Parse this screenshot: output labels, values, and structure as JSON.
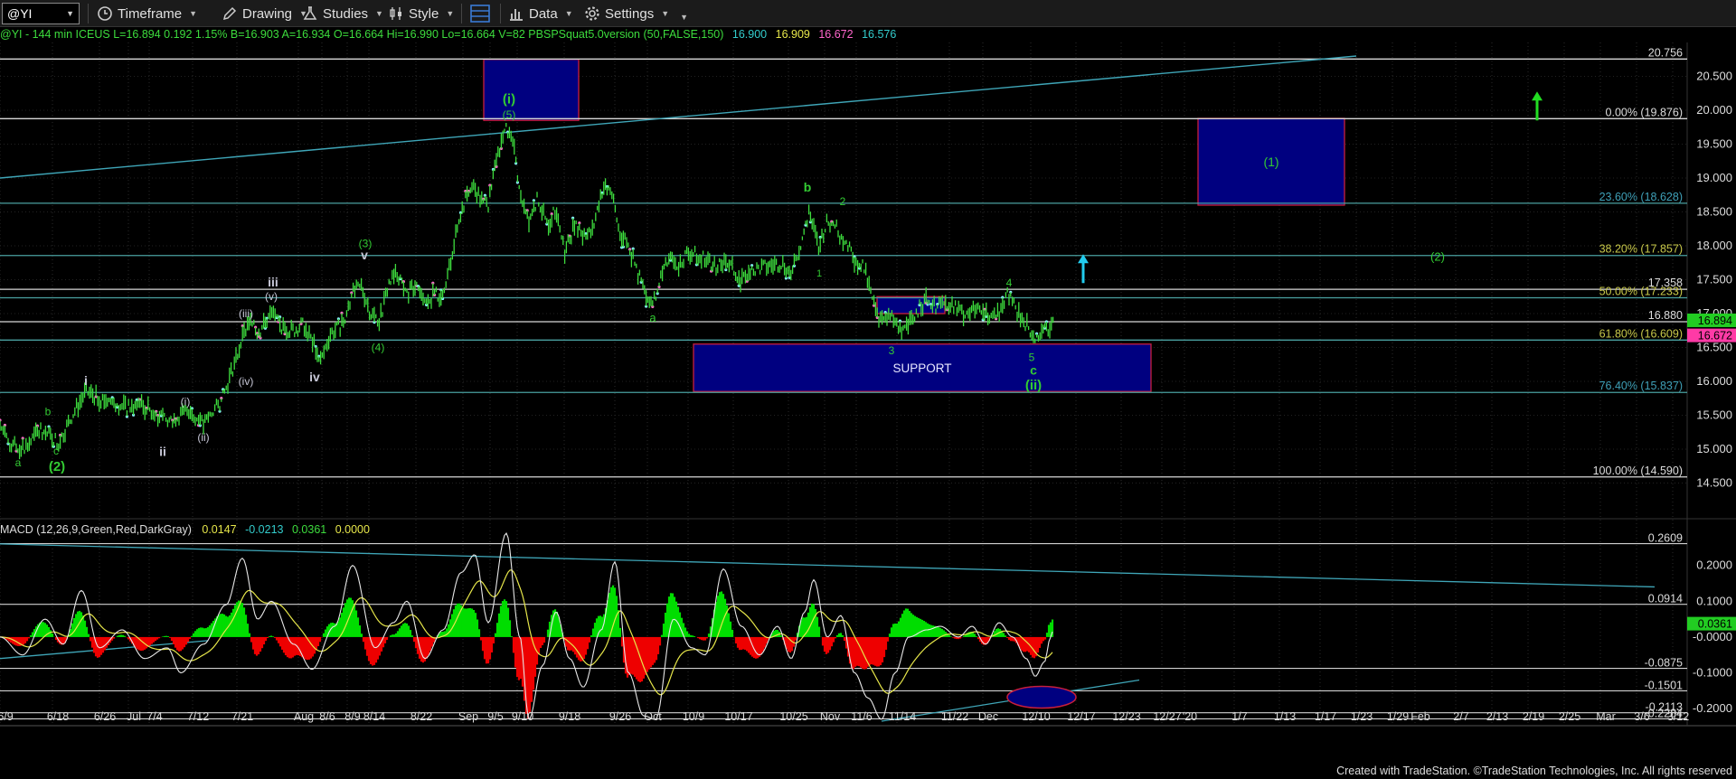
{
  "toolbar": {
    "symbol": "@YI",
    "timeframe": "Timeframe",
    "drawing": "Drawing",
    "studies": "Studies",
    "style": "Style",
    "data": "Data",
    "settings": "Settings"
  },
  "infobar": {
    "main": "@YI - 144 min  ICEUS  L=16.894  0.192  1.15%  B=16.903  A=16.934  O=16.664  Hi=16.990  Lo=16.664  V=82  PBSPSquat5.0version (50,FALSE,150)",
    "v1": "16.900",
    "v2": "16.909",
    "v3": "16.672",
    "v4": "16.576"
  },
  "colors": {
    "price": "#3ddc3d",
    "wave_green": "#33cc33",
    "wave_gray": "#c8c8d8",
    "fib": "#4aa0a0",
    "hline": "#d8d8d8",
    "box_fill": "#000080",
    "box_edge": "#c81e3c",
    "trend": "#3fa6b8",
    "macd": "#e8e8e8",
    "signal": "#e6e64a",
    "hist_pos": "#00dd00",
    "hist_neg": "#ee0000",
    "arrow_cyan": "#22ccee",
    "arrow_green": "#22dd22"
  },
  "chart_data": [
    {
      "type": "line",
      "series_name": "@YI - 144 min",
      "ylim": [
        14.0,
        21.0
      ],
      "y_ticks": [
        14.5,
        15.0,
        15.5,
        16.0,
        16.5,
        17.0,
        17.5,
        18.0,
        18.5,
        19.0,
        19.5,
        20.0,
        20.5
      ],
      "y_tick_labels": [
        "14.500",
        "15.000",
        "15.500",
        "16.000",
        "16.500",
        "17.000",
        "17.500",
        "18.000",
        "18.500",
        "19.000",
        "19.500",
        "20.000",
        "20.500"
      ],
      "x_tick_labels": [
        "6/9",
        "6/18",
        "6/26",
        "Jul",
        "7/4",
        "7/12",
        "7/21",
        "Aug",
        "8/6",
        "8/9",
        "8/14",
        "8/22",
        "Sep",
        "9/5",
        "9/10",
        "9/18",
        "9/26",
        "Oct",
        "10/9",
        "10/17",
        "10/25",
        "Nov",
        "11/6",
        "11/14",
        "11/22",
        "Dec",
        "12/10",
        "12/17",
        "12/23",
        "12/27",
        "'20",
        "1/7",
        "1/13",
        "1/17",
        "1/23",
        "1/29",
        "Feb",
        "2/7",
        "2/13",
        "2/19",
        "2/25",
        "Mar",
        "3/6",
        "3/12"
      ],
      "x_tick_pos": [
        0,
        0.058,
        0.11,
        0.142,
        0.165,
        0.213,
        0.262,
        0.33,
        0.356,
        0.384,
        0.408,
        0.46,
        0.512,
        0.542,
        0.572,
        0.624,
        0.68,
        0.716,
        0.761,
        0.811,
        0.872,
        0.912,
        0.947,
        0.992,
        1.05,
        1.087,
        1.14,
        1.19,
        1.24,
        1.285,
        1.31,
        1.365,
        1.415,
        1.46,
        1.5,
        1.54,
        1.565,
        1.61,
        1.65,
        1.69,
        1.73,
        1.77,
        1.81,
        1.85
      ],
      "price_path": [
        [
          0,
          15.35
        ],
        [
          0.01,
          15.1
        ],
        [
          0.02,
          15.0
        ],
        [
          0.03,
          15.05
        ],
        [
          0.045,
          15.3
        ],
        [
          0.055,
          15.2
        ],
        [
          0.065,
          15.1
        ],
        [
          0.08,
          15.5
        ],
        [
          0.095,
          15.85
        ],
        [
          0.11,
          15.75
        ],
        [
          0.125,
          15.7
        ],
        [
          0.14,
          15.6
        ],
        [
          0.155,
          15.65
        ],
        [
          0.17,
          15.55
        ],
        [
          0.185,
          15.4
        ],
        [
          0.2,
          15.5
        ],
        [
          0.21,
          15.6
        ],
        [
          0.225,
          15.35
        ],
        [
          0.235,
          15.55
        ],
        [
          0.245,
          15.7
        ],
        [
          0.255,
          16.1
        ],
        [
          0.265,
          16.5
        ],
        [
          0.275,
          16.9
        ],
        [
          0.285,
          16.7
        ],
        [
          0.295,
          16.9
        ],
        [
          0.3,
          17.0
        ],
        [
          0.31,
          16.8
        ],
        [
          0.325,
          16.75
        ],
        [
          0.335,
          16.85
        ],
        [
          0.345,
          16.6
        ],
        [
          0.355,
          16.3
        ],
        [
          0.365,
          16.7
        ],
        [
          0.38,
          16.85
        ],
        [
          0.39,
          17.3
        ],
        [
          0.4,
          17.4
        ],
        [
          0.41,
          17.0
        ],
        [
          0.42,
          16.9
        ],
        [
          0.43,
          17.45
        ],
        [
          0.44,
          17.6
        ],
        [
          0.45,
          17.3
        ],
        [
          0.46,
          17.4
        ],
        [
          0.47,
          17.1
        ],
        [
          0.48,
          17.3
        ],
        [
          0.49,
          17.2
        ],
        [
          0.5,
          17.9
        ],
        [
          0.51,
          18.5
        ],
        [
          0.52,
          18.9
        ],
        [
          0.53,
          18.7
        ],
        [
          0.54,
          18.6
        ],
        [
          0.55,
          19.3
        ],
        [
          0.56,
          19.75
        ],
        [
          0.568,
          19.5
        ],
        [
          0.575,
          18.8
        ],
        [
          0.585,
          18.4
        ],
        [
          0.595,
          18.7
        ],
        [
          0.605,
          18.3
        ],
        [
          0.615,
          18.55
        ],
        [
          0.625,
          17.9
        ],
        [
          0.635,
          18.3
        ],
        [
          0.645,
          18.15
        ],
        [
          0.655,
          18.2
        ],
        [
          0.665,
          18.8
        ],
        [
          0.675,
          18.85
        ],
        [
          0.685,
          18.2
        ],
        [
          0.695,
          18.0
        ],
        [
          0.705,
          17.6
        ],
        [
          0.715,
          17.3
        ],
        [
          0.722,
          17.15
        ],
        [
          0.73,
          17.5
        ],
        [
          0.74,
          17.8
        ],
        [
          0.75,
          17.7
        ],
        [
          0.76,
          17.9
        ],
        [
          0.775,
          17.85
        ],
        [
          0.79,
          17.7
        ],
        [
          0.805,
          17.75
        ],
        [
          0.82,
          17.5
        ],
        [
          0.835,
          17.65
        ],
        [
          0.85,
          17.7
        ],
        [
          0.865,
          17.75
        ],
        [
          0.875,
          17.6
        ],
        [
          0.885,
          18.0
        ],
        [
          0.895,
          18.5
        ],
        [
          0.905,
          18.0
        ],
        [
          0.915,
          18.35
        ],
        [
          0.925,
          18.25
        ],
        [
          0.935,
          18.05
        ],
        [
          0.945,
          17.8
        ],
        [
          0.955,
          17.7
        ],
        [
          0.965,
          17.2
        ],
        [
          0.975,
          16.85
        ],
        [
          0.985,
          16.95
        ],
        [
          0.995,
          16.75
        ],
        [
          1.005,
          16.9
        ],
        [
          1.015,
          17.05
        ],
        [
          1.025,
          17.2
        ],
        [
          1.035,
          17.1
        ],
        [
          1.05,
          17.15
        ],
        [
          1.065,
          17.0
        ],
        [
          1.08,
          17.05
        ],
        [
          1.095,
          16.95
        ],
        [
          1.105,
          17.0
        ],
        [
          1.115,
          17.3
        ],
        [
          1.125,
          17.0
        ],
        [
          1.135,
          16.85
        ],
        [
          1.143,
          16.62
        ],
        [
          1.15,
          16.7
        ],
        [
          1.158,
          16.76
        ],
        [
          1.165,
          16.9
        ]
      ],
      "h_lines": [
        {
          "value": 20.756,
          "label": "20.756"
        },
        {
          "value": 19.876,
          "label": "0.00% (19.876)",
          "kind": "fib"
        },
        {
          "value": 18.628,
          "label": "23.60% (18.628)",
          "kind": "fib"
        },
        {
          "value": 17.857,
          "label": "38.20% (17.857)",
          "kind": "fib"
        },
        {
          "value": 17.358,
          "label": "17.358"
        },
        {
          "value": 17.233,
          "label": "50.00% (17.233)",
          "kind": "fib"
        },
        {
          "value": 16.88,
          "label": "16.880"
        },
        {
          "value": 16.609,
          "label": "61.80% (16.609)",
          "kind": "fib"
        },
        {
          "value": 15.837,
          "label": "76.40% (15.837)",
          "kind": "fib"
        },
        {
          "value": 14.59,
          "label": "100.00% (14.590)"
        }
      ],
      "price_tags": [
        {
          "value": 16.894,
          "label": "16.894",
          "bg": "#22cc22"
        },
        {
          "value": 16.672,
          "label": "16.672",
          "bg": "#ff3aa6"
        }
      ],
      "trendline": [
        [
          0,
          19.0
        ],
        [
          1.5,
          20.8
        ]
      ],
      "boxes": [
        {
          "x0": 0.535,
          "x1": 0.64,
          "y0": 19.85,
          "y1": 20.75,
          "label": ""
        },
        {
          "x0": 1.325,
          "x1": 1.487,
          "y0": 18.6,
          "y1": 19.88,
          "label": "(1)"
        },
        {
          "x0": 0.767,
          "x1": 1.273,
          "y0": 15.85,
          "y1": 16.55,
          "label": "SUPPORT"
        },
        {
          "x0": 0.97,
          "x1": 1.045,
          "y0": 17.0,
          "y1": 17.25,
          "label": ""
        }
      ],
      "wave_labels": [
        {
          "x": 0.02,
          "y": 14.75,
          "t": "a",
          "c": "g",
          "s": 12
        },
        {
          "x": 0.053,
          "y": 15.5,
          "t": "b",
          "c": "g",
          "s": 12
        },
        {
          "x": 0.062,
          "y": 14.92,
          "t": "c",
          "c": "g",
          "s": 12
        },
        {
          "x": 0.063,
          "y": 14.68,
          "t": "(2)",
          "c": "g",
          "s": 15
        },
        {
          "x": 0.095,
          "y": 15.95,
          "t": "i",
          "c": "w",
          "s": 14
        },
        {
          "x": 0.18,
          "y": 14.9,
          "t": "ii",
          "c": "w",
          "s": 14
        },
        {
          "x": 0.205,
          "y": 15.65,
          "t": "(i)",
          "c": "w",
          "s": 12
        },
        {
          "x": 0.225,
          "y": 15.12,
          "t": "(ii)",
          "c": "w",
          "s": 12
        },
        {
          "x": 0.272,
          "y": 16.95,
          "t": "(iii)",
          "c": "w",
          "s": 12
        },
        {
          "x": 0.272,
          "y": 15.95,
          "t": "(iv)",
          "c": "w",
          "s": 12
        },
        {
          "x": 0.3,
          "y": 17.2,
          "t": "(v)",
          "c": "w",
          "s": 12
        },
        {
          "x": 0.302,
          "y": 17.4,
          "t": "iii",
          "c": "w",
          "s": 14
        },
        {
          "x": 0.348,
          "y": 16.0,
          "t": "iv",
          "c": "w",
          "s": 14
        },
        {
          "x": 0.403,
          "y": 17.8,
          "t": "v",
          "c": "w",
          "s": 14
        },
        {
          "x": 0.404,
          "y": 17.98,
          "t": "(3)",
          "c": "g",
          "s": 12
        },
        {
          "x": 0.418,
          "y": 16.45,
          "t": "(4)",
          "c": "g",
          "s": 12
        },
        {
          "x": 0.563,
          "y": 20.1,
          "t": "(i)",
          "c": "g",
          "s": 15
        },
        {
          "x": 0.563,
          "y": 19.88,
          "t": "(5)",
          "c": "g",
          "s": 12
        },
        {
          "x": 0.722,
          "y": 16.88,
          "t": "a",
          "c": "g",
          "s": 13
        },
        {
          "x": 0.893,
          "y": 18.8,
          "t": "b",
          "c": "g",
          "s": 14
        },
        {
          "x": 0.906,
          "y": 17.55,
          "t": "1",
          "c": "g",
          "s": 11
        },
        {
          "x": 0.932,
          "y": 18.6,
          "t": "2",
          "c": "g",
          "s": 12
        },
        {
          "x": 0.986,
          "y": 16.4,
          "t": "3",
          "c": "g",
          "s": 12
        },
        {
          "x": 1.116,
          "y": 17.4,
          "t": "4",
          "c": "g",
          "s": 12
        },
        {
          "x": 1.141,
          "y": 16.3,
          "t": "5",
          "c": "g",
          "s": 12
        },
        {
          "x": 1.143,
          "y": 16.1,
          "t": "c",
          "c": "g",
          "s": 14
        },
        {
          "x": 1.143,
          "y": 15.88,
          "t": "(ii)",
          "c": "g",
          "s": 15
        },
        {
          "x": 1.59,
          "y": 17.78,
          "t": "(2)",
          "c": "g",
          "s": 13
        }
      ],
      "arrows": [
        {
          "x": 1.198,
          "y0": 17.45,
          "y1": 17.85,
          "color": "cyan"
        },
        {
          "x": 1.7,
          "y0": 19.85,
          "y1": 20.25,
          "color": "green"
        }
      ]
    },
    {
      "type": "line",
      "indicator": "MACD (12,26,9,Green,Red,DarkGray)",
      "header_values": [
        "0.0147",
        "-0.0213",
        "0.0361",
        "0.0000"
      ],
      "ylim": [
        -0.245,
        0.29
      ],
      "y_ticks": [
        -0.2,
        -0.1,
        0.0,
        0.1,
        0.2
      ],
      "y_tick_labels": [
        "-0.2000",
        "-0.1000",
        "-0.0000",
        "0.1000",
        "0.2000"
      ],
      "h_lines": [
        {
          "value": 0.2609,
          "label": "0.2609"
        },
        {
          "value": 0.0914,
          "label": "0.0914"
        },
        {
          "value": -0.0875,
          "label": "-0.0875"
        },
        {
          "value": -0.1501,
          "label": "-0.1501"
        },
        {
          "value": -0.2113,
          "label": "-0.2113"
        },
        {
          "value": -0.2284,
          "label": "-0.2284"
        }
      ],
      "price_tag": {
        "value": 0.0361,
        "label": "0.0361"
      },
      "macd_keys": [
        [
          0,
          0
        ],
        [
          0.025,
          -0.05
        ],
        [
          0.05,
          0.05
        ],
        [
          0.07,
          -0.02
        ],
        [
          0.09,
          0.13
        ],
        [
          0.11,
          -0.03
        ],
        [
          0.135,
          0.02
        ],
        [
          0.16,
          -0.06
        ],
        [
          0.185,
          -0.03
        ],
        [
          0.2,
          -0.1
        ],
        [
          0.225,
          -0.02
        ],
        [
          0.25,
          0.09
        ],
        [
          0.268,
          0.22
        ],
        [
          0.285,
          0.05
        ],
        [
          0.3,
          0.1
        ],
        [
          0.325,
          -0.02
        ],
        [
          0.345,
          -0.09
        ],
        [
          0.37,
          0.03
        ],
        [
          0.39,
          0.2
        ],
        [
          0.415,
          -0.03
        ],
        [
          0.435,
          0.04
        ],
        [
          0.45,
          0.1
        ],
        [
          0.47,
          -0.06
        ],
        [
          0.49,
          0.02
        ],
        [
          0.51,
          0.18
        ],
        [
          0.525,
          0.23
        ],
        [
          0.54,
          0.04
        ],
        [
          0.56,
          0.29
        ],
        [
          0.575,
          0.0
        ],
        [
          0.585,
          -0.23
        ],
        [
          0.6,
          -0.08
        ],
        [
          0.615,
          0.07
        ],
        [
          0.63,
          -0.06
        ],
        [
          0.645,
          -0.14
        ],
        [
          0.665,
          0.02
        ],
        [
          0.68,
          0.21
        ],
        [
          0.695,
          -0.1
        ],
        [
          0.712,
          -0.22
        ],
        [
          0.725,
          -0.23
        ],
        [
          0.745,
          0.05
        ],
        [
          0.765,
          -0.03
        ],
        [
          0.78,
          -0.05
        ],
        [
          0.8,
          0.19
        ],
        [
          0.82,
          0.03
        ],
        [
          0.84,
          -0.05
        ],
        [
          0.86,
          0.03
        ],
        [
          0.875,
          -0.06
        ],
        [
          0.89,
          0.07
        ],
        [
          0.9,
          0.16
        ],
        [
          0.915,
          0.0
        ],
        [
          0.93,
          0.06
        ],
        [
          0.945,
          -0.1
        ],
        [
          0.96,
          -0.17
        ],
        [
          0.975,
          -0.23
        ],
        [
          0.99,
          -0.1
        ],
        [
          1.005,
          0.0
        ],
        [
          1.025,
          0.02
        ],
        [
          1.04,
          0.03
        ],
        [
          1.06,
          0.0
        ],
        [
          1.075,
          0.03
        ],
        [
          1.09,
          -0.02
        ],
        [
          1.105,
          0.04
        ],
        [
          1.12,
          0.0
        ],
        [
          1.135,
          -0.06
        ],
        [
          1.145,
          -0.11
        ],
        [
          1.155,
          -0.07
        ],
        [
          1.162,
          0.0
        ],
        [
          1.165,
          0.02
        ]
      ],
      "trendlines": [
        [
          [
            0.0,
            0.26
          ],
          [
            1.83,
            0.14
          ]
        ],
        [
          [
            0.0,
            -0.06
          ],
          [
            0.23,
            -0.01
          ]
        ],
        [
          [
            0.975,
            -0.235
          ],
          [
            1.26,
            -0.12
          ]
        ]
      ],
      "ellipse": {
        "x": 1.152,
        "y": -0.168
      }
    }
  ],
  "footer": "Created with TradeStation. ©TradeStation Technologies, Inc. All rights reserved"
}
